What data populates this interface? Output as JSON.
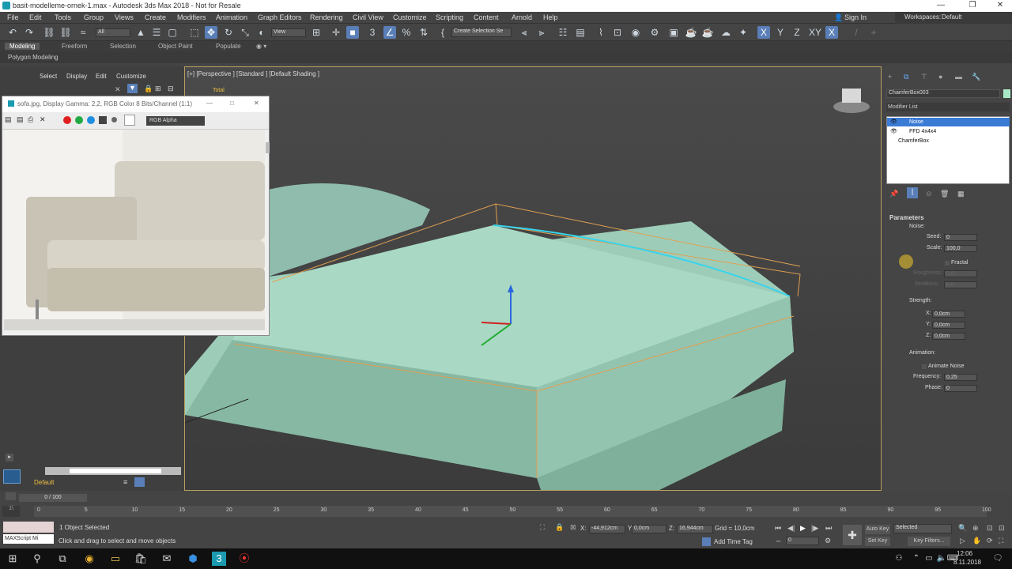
{
  "window": {
    "title": "basit-modelleme-ornek-1.max - Autodesk 3ds Max 2018 - Not for Resale"
  },
  "menu": [
    "File",
    "Edit",
    "Tools",
    "Group",
    "Views",
    "Create",
    "Modifiers",
    "Animation",
    "Graph Editors",
    "Rendering",
    "Civil View",
    "Customize",
    "Scripting",
    "Content",
    "Arnold",
    "Help"
  ],
  "account": {
    "sign_in": "Sign In",
    "workspaces_label": "Workspaces:",
    "workspace": "Default"
  },
  "toolbar": {
    "filter": "All",
    "view": "View",
    "selection_set": "Create Selection Se"
  },
  "ribbon": {
    "tabs": [
      "Modeling",
      "Freeform",
      "Selection",
      "Object Paint",
      "Populate"
    ],
    "sub": "Polygon Modeling"
  },
  "scene_explorer": {
    "menu": [
      "Select",
      "Display",
      "Edit",
      "Customize"
    ],
    "total": "Total",
    "layer": "Default"
  },
  "viewport": {
    "label": "[+] [Perspective ] [Standard ] [Default Shading ]"
  },
  "image_window": {
    "title": "sofa.jpg, Display Gamma: 2,2, RGB Color 8 Bits/Channel (1:1)",
    "channel": "RGB Alpha",
    "swatch_colors": [
      "#e02020",
      "#22aa44",
      "#1f8fe0"
    ]
  },
  "command_panel": {
    "object_name": "ChamferBox003",
    "object_color": "#a8e8c8",
    "modifier_list_label": "Modifier List",
    "stack": [
      "Noise",
      "FFD 4x4x4",
      "ChamferBox"
    ],
    "rollout_title": "Parameters",
    "noise_group": "Noise:",
    "seed_label": "Seed:",
    "seed_value": "0",
    "scale_label": "Scale:",
    "scale_value": "100,0",
    "fractal_label": "Fractal",
    "roughness_label": "Roughness:",
    "roughness_value": "0,0",
    "iterations_label": "Iterations:",
    "iterations_value": "6,0",
    "strength_group": "Strength:",
    "x_label": "X:",
    "x_value": "0,0cm",
    "y_label": "Y:",
    "y_value": "0,0cm",
    "z_label": "Z:",
    "z_value": "0,0cm",
    "animation_group": "Animation:",
    "animate_noise_label": "Animate Noise",
    "frequency_label": "Frequency:",
    "frequency_value": "0,25",
    "phase_label": "Phase:",
    "phase_value": "0"
  },
  "timeline": {
    "frame": "0 / 100",
    "ticks": [
      "0",
      "5",
      "10",
      "15",
      "20",
      "25",
      "30",
      "35",
      "40",
      "45",
      "50",
      "55",
      "60",
      "65",
      "70",
      "75",
      "80",
      "85",
      "90",
      "95",
      "100"
    ]
  },
  "status": {
    "selected": "1 Object Selected",
    "prompt": "Click and drag to select and move objects",
    "maxscript": "MAXScript Mi",
    "x_label": "X:",
    "x_value": "-44,912cm",
    "y_label": "Y:",
    "y_value": "0,0cm",
    "z_label": "Z:",
    "z_value": "16,944cm",
    "grid": "Grid = 10,0cm",
    "add_time_tag": "Add Time Tag",
    "auto_key": "Auto Key",
    "set_key": "Set Key",
    "key_mode": "Selected",
    "key_filters": "Key Filters...",
    "current_frame": "0"
  },
  "taskbar": {
    "time": "12:06",
    "date": "8.11.2018"
  }
}
